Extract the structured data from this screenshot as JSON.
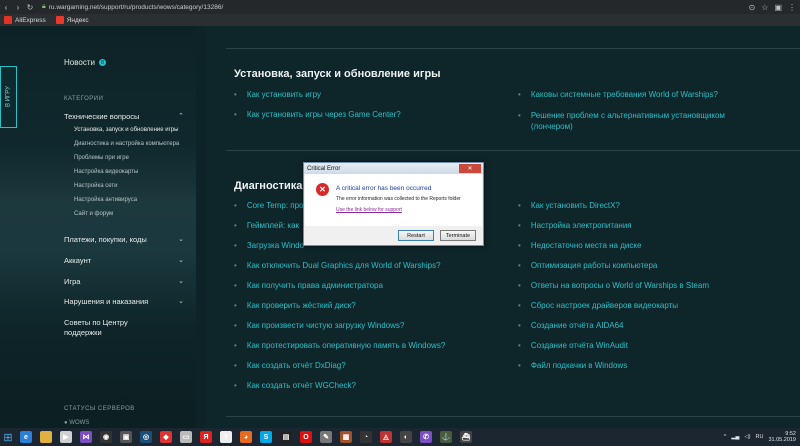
{
  "browser": {
    "url": "ru.wargaming.net/support/ru/products/wows/category/13286/",
    "bookmarks": [
      {
        "label": "AliExpress",
        "color": "#e43226"
      },
      {
        "label": "Яндекс",
        "color": "#e9382c"
      }
    ]
  },
  "sidebar": {
    "tab_label": "В ИГРУ",
    "news_label": "Новости",
    "news_badge": "8",
    "categories_label": "КАТЕГОРИИ",
    "categories": [
      {
        "label": "Технические вопросы",
        "chevron": "⌃",
        "children": [
          "Установка, запуск и обновление игры",
          "Диагностика и настройка компьютера",
          "Проблемы при игре",
          "Настройка видеокарты",
          "Настройка сети",
          "Настройка антивируса",
          "Сайт и форум"
        ]
      },
      {
        "label": "Платежи, покупки, коды",
        "chevron": "⌄"
      },
      {
        "label": "Аккаунт",
        "chevron": "⌄"
      },
      {
        "label": "Игра",
        "chevron": "⌄"
      },
      {
        "label": "Нарушения и наказания",
        "chevron": "⌄"
      }
    ],
    "support_tips": "Советы по Центру поддержки",
    "server_status_label": "СТАТУСЫ СЕРВЕРОВ",
    "server_item": "WOWS"
  },
  "main": {
    "section1_title": "Установка, запуск и обновление игры",
    "section1_left": [
      "Как установить игру",
      "Как установить игры через Game Center?"
    ],
    "section1_right": [
      "Каковы системные требования World of Warships?",
      "Решение проблем с альтернативным установщиком (лончером)"
    ],
    "section2_title": "Диагностика р",
    "section2_left": [
      "Core Temp: про",
      "Геймплей: как",
      "Загрузка Windo",
      "Как отключить Dual Graphics для World of Warships?",
      "Как получить права администратора",
      "Как проверить жёсткий диск?",
      "Как произвести чистую загрузку Windows?",
      "Как протестировать оперативную память в Windows?",
      "Как создать отчёт DxDiag?",
      "Как создать отчёт WGCheck?"
    ],
    "section2_right": [
      "Как установить DirectX?",
      "Настройка электропитания",
      "Недостаточно места на диске",
      "Оптимизация работы компьютера",
      "Ответы на вопросы о World of Warships в Steam",
      "Сброс настроек драйверов видеокарты",
      "Создание отчёта AIDA64",
      "Создание отчёта WinAudit",
      "Файл подкачки в Windows"
    ]
  },
  "dialog": {
    "title": "Critical Error",
    "close": "✕",
    "heading": "A critical error has been occurred",
    "info": "The error information was collected to the Reports folder",
    "link": "Use the link below for support",
    "restart": "Restart",
    "terminate": "Terminate"
  },
  "taskbar": {
    "icons": [
      {
        "name": "ie-icon",
        "color": "#2a7fd6",
        "glyph": "e"
      },
      {
        "name": "folder-icon",
        "color": "#e0b040",
        "glyph": ""
      },
      {
        "name": "media-icon",
        "color": "#d0d0d0",
        "glyph": "▶"
      },
      {
        "name": "vs-icon",
        "color": "#7b4fc0",
        "glyph": "⋈"
      },
      {
        "name": "player-icon",
        "color": "#333",
        "glyph": "◉"
      },
      {
        "name": "camera-icon",
        "color": "#555",
        "glyph": "▣"
      },
      {
        "name": "steam-icon",
        "color": "#1c4f78",
        "glyph": "◎"
      },
      {
        "name": "game-icon",
        "color": "#d33",
        "glyph": "◆"
      },
      {
        "name": "app-icon",
        "color": "#bbb",
        "glyph": "▭"
      },
      {
        "name": "yandex-icon",
        "color": "#d22",
        "glyph": "Я"
      },
      {
        "name": "yandex-browser-icon",
        "color": "#eee",
        "glyph": "Y"
      },
      {
        "name": "firefox-icon",
        "color": "#e66a1f",
        "glyph": "◕"
      },
      {
        "name": "skype-icon",
        "color": "#00a8e8",
        "glyph": "S"
      },
      {
        "name": "terminal-icon",
        "color": "#222",
        "glyph": "▤"
      },
      {
        "name": "opera-icon",
        "color": "#d11",
        "glyph": "O"
      },
      {
        "name": "tool-icon",
        "color": "#777",
        "glyph": "✎"
      },
      {
        "name": "archive-icon",
        "color": "#a0522d",
        "glyph": "▦"
      },
      {
        "name": "java-icon",
        "color": "#333",
        "glyph": "◔"
      },
      {
        "name": "ship-icon",
        "color": "#b33",
        "glyph": "◬"
      },
      {
        "name": "media2-icon",
        "color": "#444",
        "glyph": "◐"
      },
      {
        "name": "viber-icon",
        "color": "#7a4fc0",
        "glyph": "✆"
      },
      {
        "name": "wows-icon",
        "color": "#4a5a3a",
        "glyph": "⚓"
      },
      {
        "name": "warships-icon",
        "color": "#444",
        "glyph": "⛴"
      }
    ],
    "lang": "RU",
    "time": "9:52",
    "date": "31.05.2019"
  }
}
